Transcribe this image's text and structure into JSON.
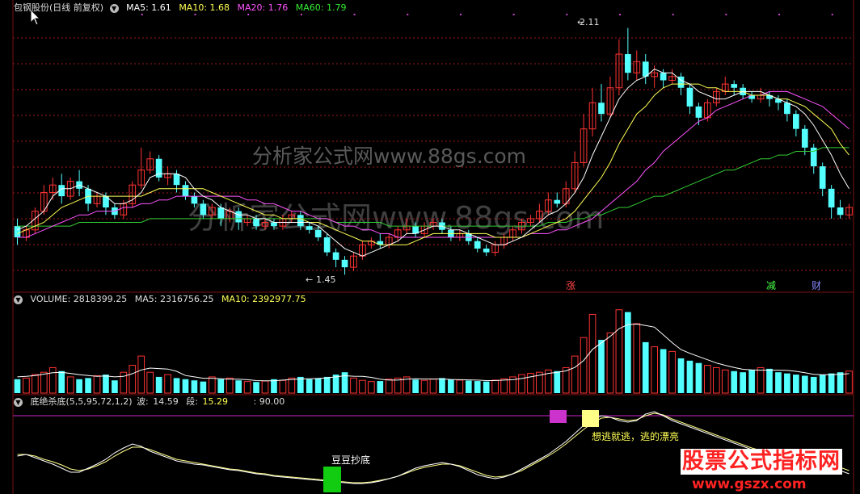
{
  "colors": {
    "up": "#ff3333",
    "down": "#54ffff",
    "ma5": "#ffffff",
    "ma10": "#ffff55",
    "ma20": "#ff55ff",
    "ma60": "#33cc33",
    "grid": "#a01818",
    "pink_line": "#cc22cc"
  },
  "main_panel": {
    "title": "包钢股份(日线 前复权)",
    "ma5": "MA5: 1.61",
    "ma10": "MA10: 1.68",
    "ma20": "MA20: 1.76",
    "ma60": "MA60: 1.79",
    "high_label": "2.11",
    "low_label": "1.45",
    "marker_zhang": "涨",
    "marker_jian": "减",
    "marker_cai": "财"
  },
  "volume_panel": {
    "volume": "VOLUME: 2818399.25",
    "ma5": "MA5: 2316756.25",
    "ma10": "MA10: 2392977.75"
  },
  "indicator_panel": {
    "name": "底绝杀底(5,5,95,72,1,2)",
    "wave_label": "波:",
    "wave_value": "14.59",
    "segment_label": "段:",
    "segment_value": "15.29",
    "level_label": ": 90.00",
    "annotation_bottom": "豆豆抄底",
    "annotation_top": "想逃就逃，逃的漂亮"
  },
  "watermarks": {
    "line1": "分析家公式网www.88gs.com",
    "line2": "分析家公式网www.88gs.com",
    "logo_cn": "股票公式指标网",
    "logo_url": "www.gszx.com"
  },
  "chart_data": {
    "type": "candlestick",
    "price_range": [
      1.45,
      2.11
    ],
    "main_marked_high": 2.11,
    "main_marked_low": 1.45,
    "ma_values": {
      "MA5": 1.61,
      "MA10": 1.68,
      "MA20": 1.76,
      "MA60": 1.79
    },
    "candles": [
      [
        1.58,
        1.55,
        1.6,
        1.53
      ],
      [
        1.55,
        1.57,
        1.58,
        1.54
      ],
      [
        1.57,
        1.62,
        1.63,
        1.56
      ],
      [
        1.62,
        1.67,
        1.69,
        1.61
      ],
      [
        1.67,
        1.69,
        1.71,
        1.65
      ],
      [
        1.69,
        1.66,
        1.72,
        1.64
      ],
      [
        1.66,
        1.7,
        1.71,
        1.65
      ],
      [
        1.7,
        1.68,
        1.73,
        1.66
      ],
      [
        1.68,
        1.64,
        1.69,
        1.62
      ],
      [
        1.64,
        1.66,
        1.67,
        1.63
      ],
      [
        1.66,
        1.63,
        1.67,
        1.61
      ],
      [
        1.63,
        1.61,
        1.64,
        1.6
      ],
      [
        1.61,
        1.64,
        1.65,
        1.6
      ],
      [
        1.64,
        1.69,
        1.7,
        1.63
      ],
      [
        1.69,
        1.73,
        1.79,
        1.68
      ],
      [
        1.73,
        1.76,
        1.78,
        1.72
      ],
      [
        1.76,
        1.71,
        1.77,
        1.7
      ],
      [
        1.71,
        1.72,
        1.74,
        1.69
      ],
      [
        1.72,
        1.69,
        1.73,
        1.67
      ],
      [
        1.69,
        1.66,
        1.7,
        1.65
      ],
      [
        1.66,
        1.64,
        1.67,
        1.63
      ],
      [
        1.64,
        1.61,
        1.65,
        1.6
      ],
      [
        1.61,
        1.63,
        1.64,
        1.6
      ],
      [
        1.63,
        1.6,
        1.64,
        1.58
      ],
      [
        1.6,
        1.62,
        1.63,
        1.59
      ],
      [
        1.62,
        1.59,
        1.63,
        1.57
      ],
      [
        1.59,
        1.6,
        1.61,
        1.58
      ],
      [
        1.6,
        1.58,
        1.61,
        1.57
      ],
      [
        1.58,
        1.59,
        1.6,
        1.57
      ],
      [
        1.59,
        1.58,
        1.6,
        1.57
      ],
      [
        1.58,
        1.6,
        1.61,
        1.57
      ],
      [
        1.6,
        1.61,
        1.62,
        1.59
      ],
      [
        1.61,
        1.58,
        1.62,
        1.57
      ],
      [
        1.58,
        1.57,
        1.59,
        1.56
      ],
      [
        1.57,
        1.55,
        1.58,
        1.54
      ],
      [
        1.55,
        1.51,
        1.56,
        1.5
      ],
      [
        1.51,
        1.49,
        1.52,
        1.47
      ],
      [
        1.49,
        1.47,
        1.5,
        1.45
      ],
      [
        1.47,
        1.5,
        1.51,
        1.46
      ],
      [
        1.5,
        1.53,
        1.54,
        1.49
      ],
      [
        1.53,
        1.54,
        1.55,
        1.52
      ],
      [
        1.54,
        1.53,
        1.56,
        1.52
      ],
      [
        1.53,
        1.55,
        1.56,
        1.52
      ],
      [
        1.55,
        1.57,
        1.58,
        1.54
      ],
      [
        1.57,
        1.58,
        1.6,
        1.56
      ],
      [
        1.58,
        1.56,
        1.59,
        1.55
      ],
      [
        1.56,
        1.58,
        1.59,
        1.55
      ],
      [
        1.58,
        1.59,
        1.6,
        1.57
      ],
      [
        1.59,
        1.57,
        1.6,
        1.56
      ],
      [
        1.57,
        1.55,
        1.58,
        1.54
      ],
      [
        1.55,
        1.56,
        1.57,
        1.54
      ],
      [
        1.56,
        1.54,
        1.57,
        1.53
      ],
      [
        1.54,
        1.52,
        1.55,
        1.51
      ],
      [
        1.52,
        1.51,
        1.53,
        1.5
      ],
      [
        1.51,
        1.53,
        1.54,
        1.5
      ],
      [
        1.53,
        1.55,
        1.56,
        1.52
      ],
      [
        1.55,
        1.57,
        1.58,
        1.54
      ],
      [
        1.57,
        1.59,
        1.6,
        1.56
      ],
      [
        1.59,
        1.6,
        1.61,
        1.58
      ],
      [
        1.6,
        1.62,
        1.64,
        1.59
      ],
      [
        1.62,
        1.65,
        1.67,
        1.61
      ],
      [
        1.65,
        1.64,
        1.67,
        1.63
      ],
      [
        1.64,
        1.68,
        1.7,
        1.63
      ],
      [
        1.68,
        1.75,
        1.78,
        1.67
      ],
      [
        1.75,
        1.84,
        1.88,
        1.74
      ],
      [
        1.84,
        1.91,
        1.95,
        1.82
      ],
      [
        1.91,
        1.88,
        1.96,
        1.86
      ],
      [
        1.88,
        1.95,
        1.98,
        1.87
      ],
      [
        1.95,
        2.04,
        2.08,
        1.93
      ],
      [
        2.04,
        1.99,
        2.11,
        1.97
      ],
      [
        1.99,
        2.02,
        2.05,
        1.97
      ],
      [
        2.02,
        1.98,
        2.04,
        1.96
      ],
      [
        1.98,
        1.99,
        2.01,
        1.95
      ],
      [
        1.99,
        1.97,
        2.0,
        1.95
      ],
      [
        1.97,
        1.98,
        2.0,
        1.96
      ],
      [
        1.98,
        1.95,
        1.99,
        1.93
      ],
      [
        1.95,
        1.9,
        1.96,
        1.88
      ],
      [
        1.9,
        1.87,
        1.91,
        1.85
      ],
      [
        1.87,
        1.91,
        1.92,
        1.86
      ],
      [
        1.91,
        1.94,
        1.95,
        1.9
      ],
      [
        1.94,
        1.96,
        1.98,
        1.93
      ],
      [
        1.96,
        1.95,
        1.97,
        1.93
      ],
      [
        1.95,
        1.93,
        1.96,
        1.92
      ],
      [
        1.93,
        1.92,
        1.94,
        1.91
      ],
      [
        1.92,
        1.93,
        1.95,
        1.91
      ],
      [
        1.93,
        1.92,
        1.94,
        1.9
      ],
      [
        1.92,
        1.91,
        1.93,
        1.89
      ],
      [
        1.91,
        1.88,
        1.92,
        1.86
      ],
      [
        1.88,
        1.84,
        1.89,
        1.82
      ],
      [
        1.84,
        1.79,
        1.85,
        1.77
      ],
      [
        1.79,
        1.74,
        1.8,
        1.72
      ],
      [
        1.74,
        1.68,
        1.75,
        1.66
      ],
      [
        1.68,
        1.63,
        1.69,
        1.6
      ],
      [
        1.63,
        1.61,
        1.65,
        1.6
      ],
      [
        1.61,
        1.63,
        1.64,
        1.6
      ]
    ],
    "ma5": [
      1.57,
      1.58,
      1.6,
      1.62,
      1.66,
      1.68,
      1.68,
      1.69,
      1.68,
      1.67,
      1.66,
      1.64,
      1.64,
      1.65,
      1.67,
      1.71,
      1.72,
      1.72,
      1.72,
      1.71,
      1.68,
      1.66,
      1.65,
      1.63,
      1.62,
      1.61,
      1.61,
      1.6,
      1.6,
      1.59,
      1.59,
      1.59,
      1.59,
      1.59,
      1.58,
      1.56,
      1.54,
      1.52,
      1.51,
      1.5,
      1.51,
      1.52,
      1.53,
      1.54,
      1.56,
      1.56,
      1.57,
      1.58,
      1.58,
      1.57,
      1.57,
      1.56,
      1.55,
      1.54,
      1.53,
      1.53,
      1.54,
      1.55,
      1.57,
      1.59,
      1.61,
      1.62,
      1.64,
      1.67,
      1.71,
      1.77,
      1.82,
      1.87,
      1.92,
      1.95,
      1.97,
      1.98,
      2.0,
      1.99,
      1.99,
      1.97,
      1.96,
      1.94,
      1.93,
      1.92,
      1.92,
      1.93,
      1.94,
      1.94,
      1.94,
      1.93,
      1.92,
      1.91,
      1.9,
      1.88,
      1.85,
      1.81,
      1.77,
      1.72,
      1.68
    ],
    "ma10": [
      1.56,
      1.57,
      1.58,
      1.59,
      1.61,
      1.63,
      1.64,
      1.65,
      1.66,
      1.66,
      1.66,
      1.66,
      1.66,
      1.66,
      1.66,
      1.67,
      1.68,
      1.68,
      1.68,
      1.68,
      1.68,
      1.68,
      1.67,
      1.66,
      1.65,
      1.64,
      1.63,
      1.62,
      1.61,
      1.61,
      1.6,
      1.6,
      1.6,
      1.59,
      1.59,
      1.58,
      1.57,
      1.56,
      1.55,
      1.54,
      1.54,
      1.53,
      1.53,
      1.53,
      1.53,
      1.54,
      1.55,
      1.56,
      1.56,
      1.56,
      1.56,
      1.56,
      1.56,
      1.56,
      1.55,
      1.55,
      1.55,
      1.55,
      1.56,
      1.57,
      1.58,
      1.59,
      1.6,
      1.62,
      1.65,
      1.68,
      1.71,
      1.75,
      1.8,
      1.84,
      1.88,
      1.9,
      1.93,
      1.95,
      1.96,
      1.96,
      1.96,
      1.96,
      1.95,
      1.95,
      1.94,
      1.94,
      1.94,
      1.93,
      1.93,
      1.93,
      1.92,
      1.92,
      1.91,
      1.9,
      1.88,
      1.86,
      1.84,
      1.8,
      1.77
    ],
    "ma20": [
      1.55,
      1.55,
      1.56,
      1.57,
      1.58,
      1.59,
      1.6,
      1.61,
      1.61,
      1.62,
      1.62,
      1.62,
      1.63,
      1.63,
      1.64,
      1.64,
      1.65,
      1.65,
      1.66,
      1.66,
      1.66,
      1.66,
      1.66,
      1.66,
      1.66,
      1.66,
      1.65,
      1.65,
      1.64,
      1.64,
      1.63,
      1.62,
      1.62,
      1.61,
      1.6,
      1.6,
      1.59,
      1.58,
      1.58,
      1.57,
      1.57,
      1.56,
      1.56,
      1.55,
      1.55,
      1.55,
      1.55,
      1.55,
      1.55,
      1.55,
      1.55,
      1.55,
      1.55,
      1.55,
      1.55,
      1.55,
      1.55,
      1.55,
      1.56,
      1.56,
      1.56,
      1.57,
      1.57,
      1.58,
      1.59,
      1.6,
      1.62,
      1.64,
      1.66,
      1.68,
      1.7,
      1.73,
      1.75,
      1.78,
      1.8,
      1.82,
      1.84,
      1.86,
      1.87,
      1.89,
      1.9,
      1.91,
      1.92,
      1.93,
      1.93,
      1.94,
      1.94,
      1.94,
      1.93,
      1.92,
      1.91,
      1.9,
      1.88,
      1.86,
      1.84
    ],
    "ma60": [
      1.58,
      1.58,
      1.58,
      1.58,
      1.58,
      1.58,
      1.58,
      1.59,
      1.59,
      1.59,
      1.59,
      1.59,
      1.59,
      1.59,
      1.59,
      1.6,
      1.6,
      1.6,
      1.6,
      1.6,
      1.6,
      1.6,
      1.6,
      1.6,
      1.6,
      1.6,
      1.6,
      1.6,
      1.6,
      1.6,
      1.6,
      1.6,
      1.6,
      1.6,
      1.6,
      1.6,
      1.59,
      1.59,
      1.59,
      1.59,
      1.59,
      1.59,
      1.58,
      1.58,
      1.58,
      1.58,
      1.58,
      1.58,
      1.58,
      1.58,
      1.58,
      1.58,
      1.58,
      1.58,
      1.58,
      1.58,
      1.58,
      1.58,
      1.58,
      1.58,
      1.59,
      1.59,
      1.59,
      1.6,
      1.6,
      1.61,
      1.61,
      1.62,
      1.63,
      1.63,
      1.64,
      1.65,
      1.66,
      1.66,
      1.67,
      1.68,
      1.69,
      1.7,
      1.71,
      1.72,
      1.73,
      1.73,
      1.74,
      1.75,
      1.76,
      1.76,
      1.77,
      1.77,
      1.78,
      1.78,
      1.78,
      1.79,
      1.79,
      1.79,
      1.79
    ],
    "volume_scale_max": 3800000,
    "volumes": [
      600000,
      650000,
      800000,
      900000,
      1100000,
      950000,
      700000,
      600000,
      650000,
      750000,
      800000,
      550000,
      900000,
      1200000,
      1600000,
      900000,
      700000,
      800000,
      650000,
      600000,
      550000,
      500000,
      700000,
      600000,
      650000,
      550000,
      500000,
      480000,
      520000,
      600000,
      550000,
      650000,
      700000,
      600000,
      650000,
      700000,
      800000,
      900000,
      650000,
      550000,
      500000,
      520000,
      600000,
      650000,
      700000,
      580000,
      550000,
      600000,
      650000,
      580000,
      560000,
      540000,
      520000,
      500000,
      560000,
      620000,
      700000,
      800000,
      850000,
      900000,
      1000000,
      950000,
      1100000,
      1600000,
      2400000,
      3400000,
      2300000,
      2600000,
      3600000,
      3500000,
      3000000,
      2200000,
      2000000,
      1900000,
      1800000,
      1500000,
      1400000,
      1300000,
      1200000,
      1100000,
      1000000,
      950000,
      900000,
      1000000,
      1100000,
      1050000,
      900000,
      850000,
      800000,
      750000,
      700000,
      800000,
      850000,
      900000,
      950000
    ],
    "vol_ma5": [
      700000,
      720000,
      760000,
      820000,
      880000,
      900000,
      850000,
      800000,
      760000,
      720000,
      740000,
      700000,
      720000,
      840000,
      1000000,
      1080000,
      1060000,
      1040000,
      940000,
      760000,
      700000,
      640000,
      640000,
      620000,
      600000,
      600000,
      580000,
      540000,
      530000,
      530000,
      560000,
      590000,
      610000,
      620000,
      630000,
      660000,
      700000,
      750000,
      730000,
      720000,
      680000,
      600000,
      560000,
      560000,
      600000,
      620000,
      610000,
      610000,
      610000,
      590000,
      580000,
      570000,
      560000,
      540000,
      540000,
      560000,
      580000,
      630000,
      700000,
      770000,
      850000,
      900000,
      960000,
      1110000,
      1410000,
      1890000,
      2170000,
      2450000,
      2780000,
      2960000,
      2980000,
      2920000,
      2850000,
      2520000,
      2180000,
      1880000,
      1720000,
      1580000,
      1440000,
      1300000,
      1200000,
      1110000,
      1030000,
      1000000,
      990000,
      990000,
      990000,
      980000,
      940000,
      880000,
      810000,
      790000,
      800000,
      810000,
      840000
    ],
    "indicator": {
      "wave_value": 14.59,
      "segment_value": 15.29,
      "level": 90.0,
      "wave": [
        40,
        42,
        38,
        34,
        30,
        25,
        20,
        20,
        25,
        30,
        36,
        44,
        50,
        55,
        52,
        46,
        42,
        38,
        34,
        32,
        30,
        29,
        27,
        25,
        23,
        22,
        20,
        18,
        17,
        15,
        14,
        13,
        12,
        11,
        10,
        9,
        8,
        7,
        6,
        6,
        7,
        9,
        12,
        15,
        20,
        25,
        28,
        30,
        32,
        30,
        27,
        22,
        17,
        14,
        12,
        14,
        18,
        24,
        30,
        36,
        42,
        50,
        58,
        68,
        78,
        85,
        90,
        88,
        84,
        82,
        84,
        92,
        95,
        90,
        84,
        80,
        76,
        72,
        68,
        64,
        60,
        56,
        52,
        48,
        45,
        42,
        40,
        38,
        36,
        34,
        32,
        30,
        26,
        22,
        18
      ],
      "segment": [
        42,
        42,
        40,
        36,
        33,
        29,
        24,
        22,
        24,
        28,
        33,
        40,
        46,
        51,
        51,
        48,
        44,
        40,
        36,
        34,
        32,
        30,
        28,
        26,
        24,
        23,
        21,
        19,
        18,
        16,
        15,
        14,
        13,
        12,
        11,
        10,
        9,
        8,
        7,
        7,
        8,
        10,
        12,
        15,
        19,
        23,
        26,
        28,
        30,
        30,
        28,
        24,
        20,
        16,
        14,
        15,
        18,
        22,
        28,
        34,
        40,
        47,
        55,
        64,
        73,
        81,
        87,
        88,
        86,
        84,
        85,
        90,
        93,
        91,
        86,
        82,
        78,
        74,
        70,
        66,
        62,
        58,
        54,
        50,
        47,
        44,
        42,
        40,
        38,
        36,
        34,
        32,
        29,
        26,
        22
      ]
    }
  }
}
